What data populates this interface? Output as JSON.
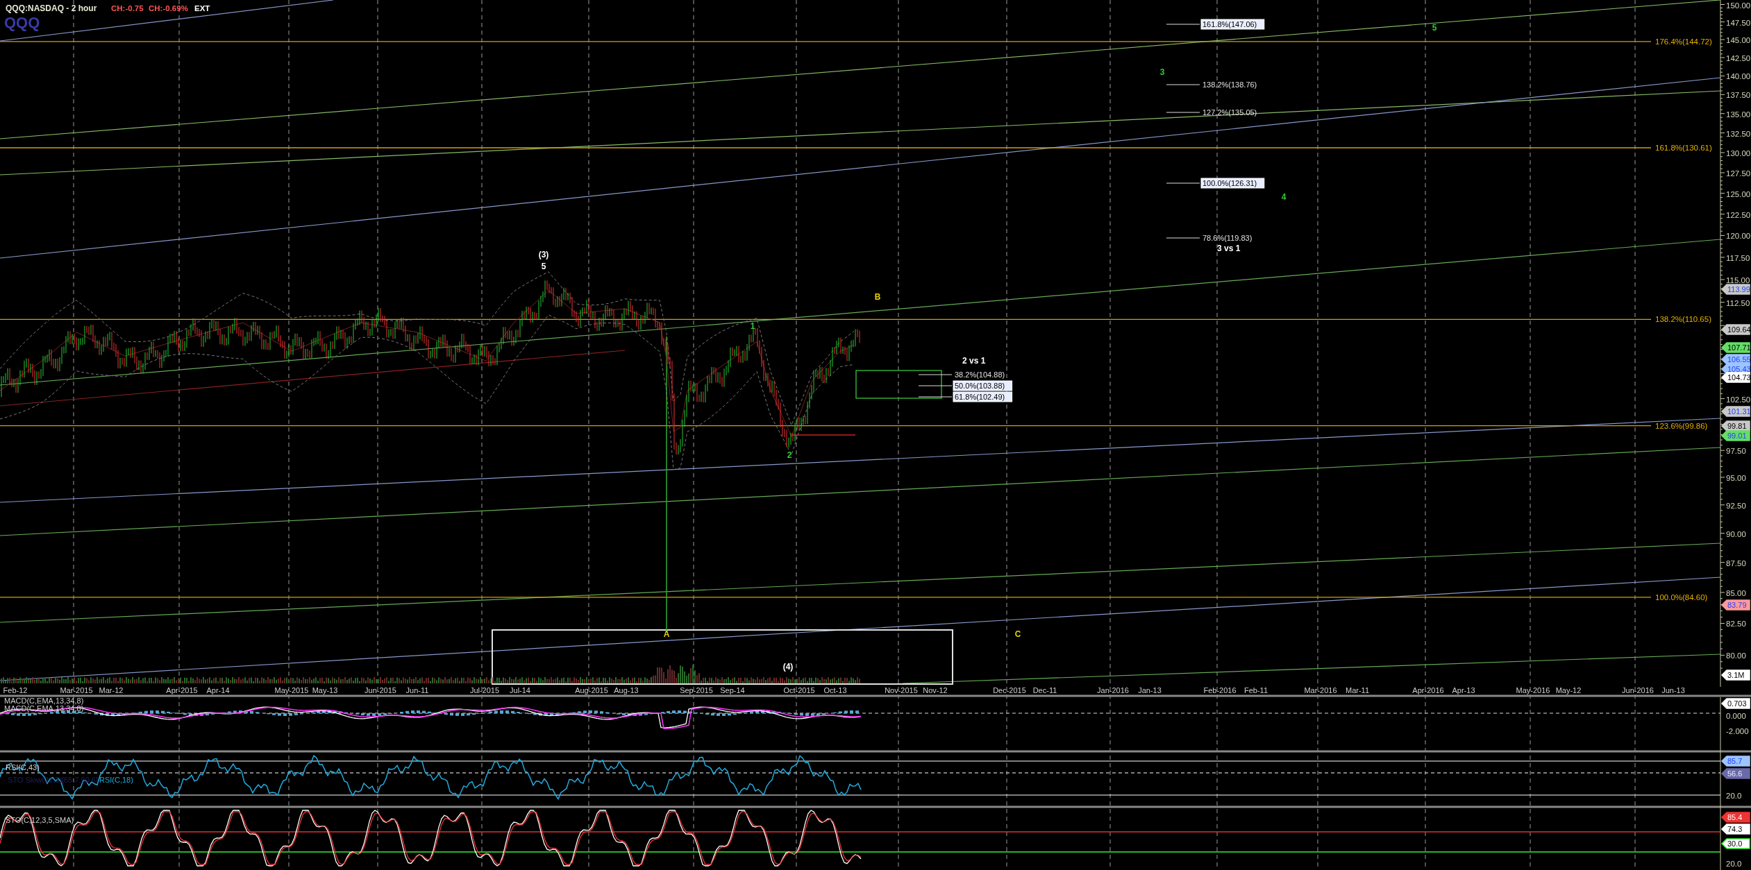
{
  "header": {
    "symbol": "QQQ:NASDAQ",
    "interval": "- 2 hour",
    "change": "CH:-0.75",
    "change_pct": "CH:-0.69%",
    "session": "EXT",
    "symbol_badge": "QQQ"
  },
  "price_chart": {
    "y_ticks": [
      "150.00",
      "147.50",
      "145.00",
      "142.50",
      "140.00",
      "137.50",
      "135.00",
      "132.50",
      "130.00",
      "127.50",
      "125.00",
      "122.50",
      "120.00",
      "117.50",
      "115.00",
      "112.50",
      "102.50",
      "97.50",
      "95.00",
      "92.50",
      "90.00",
      "87.50",
      "85.00",
      "82.50",
      "80.00"
    ],
    "x_labels": [
      "Feb-12",
      "Mar-2015",
      "Mar-12",
      "Apr-2015",
      "Apr-14",
      "May-2015",
      "May-13",
      "Jun-2015",
      "Jun-11",
      "Jul-2015",
      "Jul-14",
      "Aug-2015",
      "Aug-13",
      "Sep-2015",
      "Sep-14",
      "Oct-2015",
      "Oct-13",
      "Nov-2015",
      "Nov-12",
      "Dec-2015",
      "Dec-11",
      "Jan-2016",
      "Jan-13",
      "Feb-2016",
      "Feb-11",
      "Mar-2016",
      "Mar-11",
      "Apr-2016",
      "Apr-13",
      "May-2016",
      "May-12",
      "Jun-2016",
      "Jun-13"
    ],
    "price_tags": [
      {
        "text": "113.99",
        "kind": "steel"
      },
      {
        "text": "109.64",
        "kind": "grey"
      },
      {
        "text": "107.71",
        "kind": "green"
      },
      {
        "text": "106.55",
        "kind": "sky"
      },
      {
        "text": "105.43",
        "kind": "sky"
      },
      {
        "text": "104.73",
        "kind": "white"
      },
      {
        "text": "101.31",
        "kind": "steel"
      },
      {
        "text": "99.81",
        "kind": "grey"
      },
      {
        "text": "99.01",
        "kind": "emerald"
      },
      {
        "text": "83.79",
        "kind": "salmon"
      },
      {
        "text": "3.1M",
        "kind": "white"
      }
    ],
    "fib_levels": [
      "176.4%(144.72)",
      "161.8%(130.61)",
      "138.2%(110.65)",
      "123.6%(99.86)",
      "100.0%(84.60)"
    ],
    "projections": [
      {
        "text": "161.8%(147.06)",
        "boxed": true
      },
      {
        "text": "138.2%(138.76)",
        "boxed": false
      },
      {
        "text": "127.2%(135.05)",
        "boxed": false
      },
      {
        "text": "100.0%(126.31)",
        "boxed": true
      },
      {
        "text": "78.6%(119.83)",
        "boxed": false
      },
      {
        "text": "38.2%(104.88)",
        "boxed": false
      },
      {
        "text": "50.0%(103.88)",
        "boxed": true
      },
      {
        "text": "61.8%(102.49)",
        "boxed": true
      }
    ],
    "notes": [
      "3 vs 1",
      "2 vs 1"
    ],
    "wave_labels": [
      {
        "text": "(3)",
        "color": "#ffffff"
      },
      {
        "text": "5",
        "color": "#ffffff"
      },
      {
        "text": "B",
        "color": "#e8d000"
      },
      {
        "text": "1",
        "color": "#33cc33"
      },
      {
        "text": "2",
        "color": "#33cc33"
      },
      {
        "text": "A",
        "color": "#e8d000"
      },
      {
        "text": "C",
        "color": "#e8d000"
      },
      {
        "text": "(4)",
        "color": "#ffffff"
      },
      {
        "text": "3",
        "color": "#33cc33"
      },
      {
        "text": "4",
        "color": "#33cc33"
      },
      {
        "text": "5",
        "color": "#33cc33"
      }
    ]
  },
  "macd": {
    "labels": [
      "MACD(C,EMA,13,34,8)",
      "MACD(C,EMA,13,34,8)"
    ],
    "y_ticks": [
      "0.000",
      "-2.000"
    ],
    "tags": [
      {
        "text": "0.703",
        "kind": "white"
      }
    ]
  },
  "rsi": {
    "labels": [
      "RSI(C,43)",
      "STO Slow(21,3)[65.7,90.6]",
      "RSI(C,18)"
    ],
    "y_ticks": [
      "20.0"
    ],
    "tags": [
      {
        "text": "85.7",
        "kind": "sky"
      },
      {
        "text": "56.6",
        "kind": "indigo"
      }
    ]
  },
  "stochastic": {
    "labels": [
      "STO(C,12,3,5,SMA)"
    ],
    "y_ticks": [
      "20.0"
    ],
    "tags": [
      {
        "text": "85.4",
        "kind": "red"
      },
      {
        "text": "74.3",
        "kind": "white"
      },
      {
        "text": "30.0",
        "kind": "outlined"
      }
    ]
  }
}
